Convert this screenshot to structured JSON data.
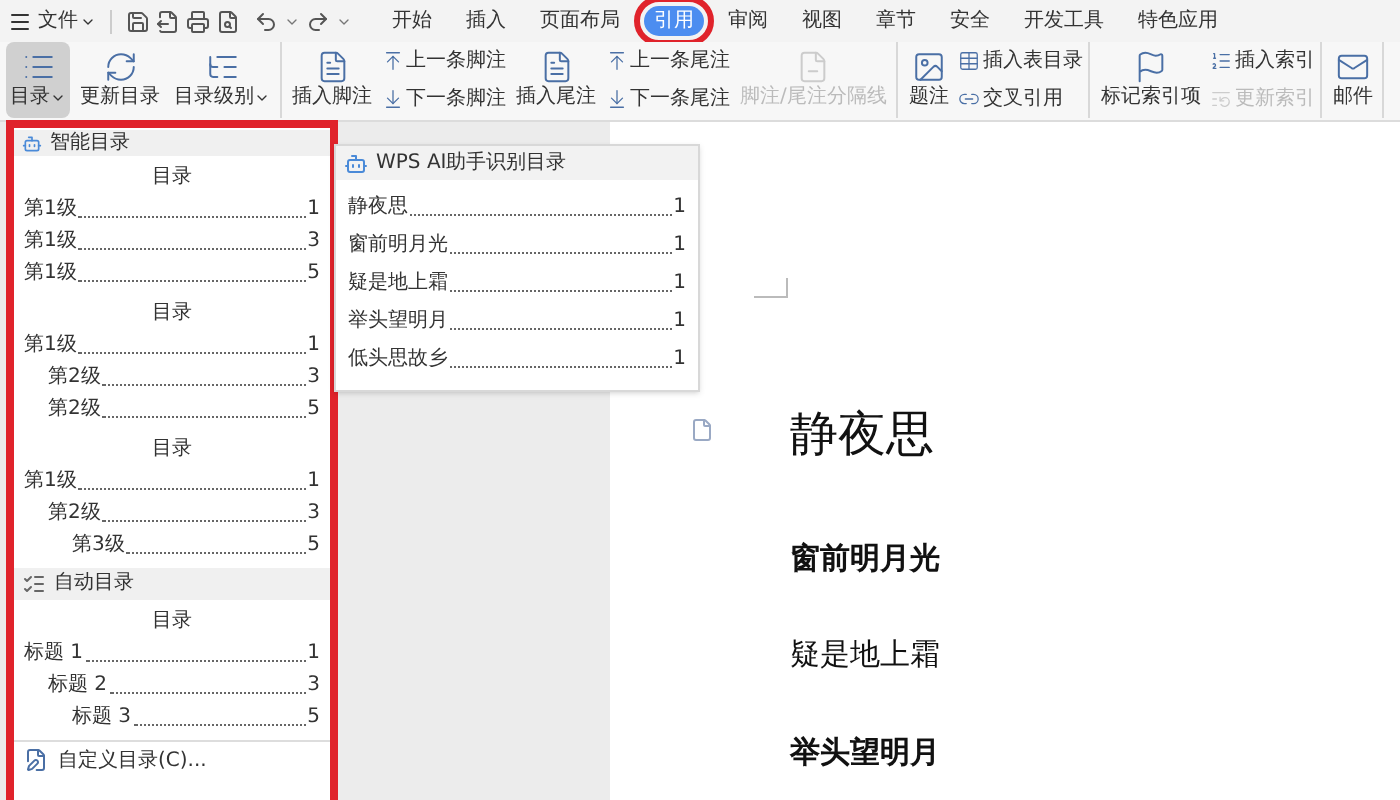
{
  "menu_bar": {
    "file_menu": "文件",
    "tabs": [
      {
        "label": "开始",
        "selected": false,
        "highlighted": false
      },
      {
        "label": "插入",
        "selected": false,
        "highlighted": false
      },
      {
        "label": "页面布局",
        "selected": false,
        "highlighted": false
      },
      {
        "label": "引用",
        "selected": true,
        "highlighted": true
      },
      {
        "label": "审阅",
        "selected": false,
        "highlighted": false
      },
      {
        "label": "视图",
        "selected": false,
        "highlighted": false
      },
      {
        "label": "章节",
        "selected": false,
        "highlighted": false
      },
      {
        "label": "安全",
        "selected": false,
        "highlighted": false
      },
      {
        "label": "开发工具",
        "selected": false,
        "highlighted": false
      },
      {
        "label": "特色应用",
        "selected": false,
        "highlighted": false
      }
    ]
  },
  "ribbon": {
    "groups": [
      {
        "items": [
          {
            "kind": "large",
            "label": "目录",
            "pressed": true,
            "dropdown": true,
            "disabled": false
          },
          {
            "kind": "large",
            "label": "更新目录",
            "pressed": false,
            "dropdown": false,
            "disabled": false
          },
          {
            "kind": "large",
            "label": "目录级别",
            "pressed": false,
            "dropdown": true,
            "disabled": false
          }
        ]
      },
      {
        "items": [
          {
            "kind": "large",
            "label": "插入脚注",
            "pressed": false,
            "dropdown": false,
            "disabled": false
          },
          {
            "kind": "small",
            "label": "上一条脚注",
            "pressed": false,
            "dropdown": false,
            "disabled": false
          },
          {
            "kind": "small",
            "label": "下一条脚注",
            "pressed": false,
            "dropdown": false,
            "disabled": false
          },
          {
            "kind": "large",
            "label": "插入尾注",
            "pressed": false,
            "dropdown": false,
            "disabled": false
          },
          {
            "kind": "small",
            "label": "上一条尾注",
            "pressed": false,
            "dropdown": false,
            "disabled": false
          },
          {
            "kind": "small",
            "label": "下一条尾注",
            "pressed": false,
            "dropdown": false,
            "disabled": false
          },
          {
            "kind": "large",
            "label": "脚注/尾注分隔线",
            "pressed": false,
            "dropdown": false,
            "disabled": true
          }
        ]
      },
      {
        "items": [
          {
            "kind": "large",
            "label": "题注",
            "pressed": false,
            "dropdown": false,
            "disabled": false
          },
          {
            "kind": "small",
            "label": "插入表目录",
            "pressed": false,
            "dropdown": false,
            "disabled": false
          },
          {
            "kind": "small",
            "label": "交叉引用",
            "pressed": false,
            "dropdown": false,
            "disabled": false
          }
        ]
      },
      {
        "items": [
          {
            "kind": "large",
            "label": "标记索引项",
            "pressed": false,
            "dropdown": false,
            "disabled": false
          },
          {
            "kind": "small",
            "label": "插入索引",
            "pressed": false,
            "dropdown": false,
            "disabled": false
          },
          {
            "kind": "small",
            "label": "更新索引",
            "pressed": false,
            "dropdown": false,
            "disabled": true
          }
        ]
      },
      {
        "items": [
          {
            "kind": "large",
            "label": "邮件",
            "pressed": false,
            "dropdown": false,
            "disabled": false
          }
        ]
      }
    ]
  },
  "toc_menu": {
    "highlighted": true,
    "sections": [
      {
        "header": "智能目录",
        "previews": [
          {
            "title": "目录",
            "entries": [
              {
                "label": "第1级",
                "page": "1"
              },
              {
                "label": "第1级",
                "page": "3"
              },
              {
                "label": "第1级",
                "page": "5"
              }
            ]
          },
          {
            "title": "目录",
            "entries": [
              {
                "label": "第1级",
                "page": "1",
                "children": [
                  {
                    "label": "第2级",
                    "page": "3"
                  },
                  {
                    "label": "第2级",
                    "page": "5"
                  }
                ]
              }
            ]
          },
          {
            "title": "目录",
            "entries": [
              {
                "label": "第1级",
                "page": "1",
                "children": [
                  {
                    "label": "第2级",
                    "page": "3",
                    "children": [
                      {
                        "label": "第3级",
                        "page": "5"
                      }
                    ]
                  }
                ]
              }
            ]
          }
        ]
      },
      {
        "header": "自动目录",
        "previews": [
          {
            "title": "目录",
            "entries": [
              {
                "label": "标题 1",
                "page": "1",
                "children": [
                  {
                    "label": "标题 2",
                    "page": "3",
                    "children": [
                      {
                        "label": "标题 3",
                        "page": "5"
                      }
                    ]
                  }
                ]
              }
            ]
          }
        ]
      }
    ],
    "custom_item": "自定义目录(C)..."
  },
  "ai_toc_panel": {
    "header": "WPS AI助手识别目录",
    "entries": [
      {
        "label": "静夜思",
        "page": "1"
      },
      {
        "label": "窗前明月光",
        "page": "1"
      },
      {
        "label": "疑是地上霜",
        "page": "1"
      },
      {
        "label": "举头望明月",
        "page": "1"
      },
      {
        "label": "低头思故乡",
        "page": "1"
      }
    ]
  },
  "document": {
    "lines": [
      {
        "kind": "title",
        "text": "静夜思"
      },
      {
        "kind": "bold",
        "text": "窗前明月光"
      },
      {
        "kind": "plain",
        "text": "疑是地上霜"
      },
      {
        "kind": "bold",
        "text": "举头望明月"
      }
    ]
  }
}
